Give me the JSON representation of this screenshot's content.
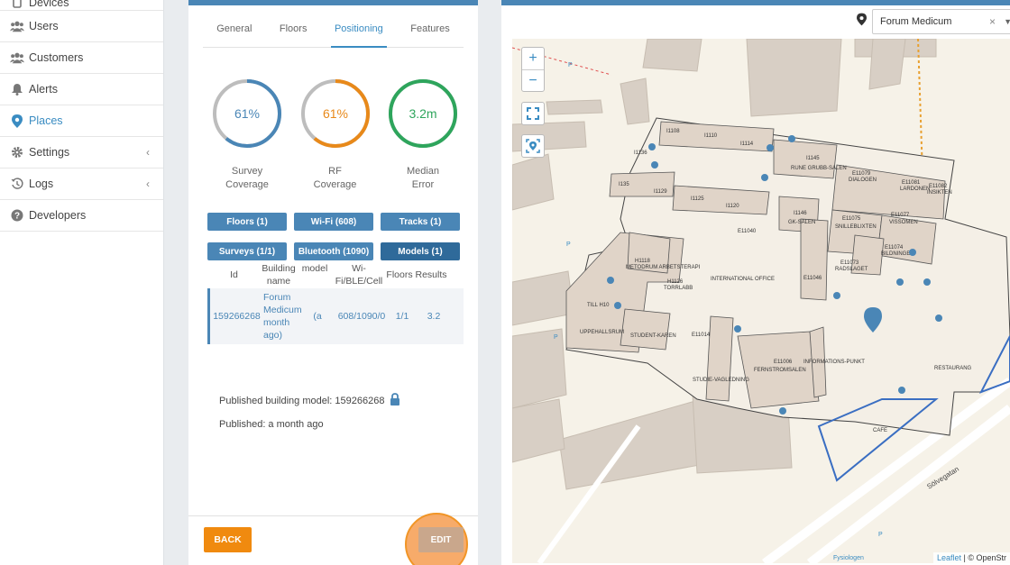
{
  "sidebar": {
    "items": [
      {
        "label": "Devices",
        "icon": "device-icon"
      },
      {
        "label": "Users",
        "icon": "users-icon"
      },
      {
        "label": "Customers",
        "icon": "customers-icon"
      },
      {
        "label": "Alerts",
        "icon": "bell-icon"
      },
      {
        "label": "Places",
        "icon": "map-pin-icon",
        "active": true
      },
      {
        "label": "Settings",
        "icon": "gear-icon"
      },
      {
        "label": "Logs",
        "icon": "history-icon"
      },
      {
        "label": "Developers",
        "icon": "help-icon"
      }
    ]
  },
  "tabs": [
    "General",
    "Floors",
    "Positioning",
    "Features"
  ],
  "active_tab": "Positioning",
  "gauges": [
    {
      "value_text": "61%",
      "fraction": 0.61,
      "color": "#4a86b6",
      "label_line1": "Survey",
      "label_line2": "Coverage"
    },
    {
      "value_text": "61%",
      "fraction": 0.61,
      "color": "#e8891a",
      "label_line1": "RF",
      "label_line2": "Coverage"
    },
    {
      "value_text": "3.2m",
      "fraction": 1.0,
      "color": "#2ea55c",
      "label_line1": "Median",
      "label_line2": "Error"
    }
  ],
  "chips": [
    "Floors (1)",
    "Wi-Fi (608)",
    "Tracks (1)",
    "Surveys (1/1)",
    "Bluetooth (1090)",
    "Models (1)"
  ],
  "models_table": {
    "headers": {
      "id": "Id",
      "building": "Building name",
      "model": "model",
      "wifi": "Wi-Fi/BLE/Cell",
      "floors": "Floors",
      "results": "Results"
    },
    "row": {
      "id": "159266268",
      "building": "Forum Medicum month ago)",
      "model": "(a",
      "wifi": "608/1090/0",
      "floors": "1/1",
      "results": "3.2"
    }
  },
  "published": {
    "model_text": "Published building model: 159266268",
    "ago_text": "Published: a month ago"
  },
  "buttons": {
    "back": "BACK",
    "edit": "EDIT"
  },
  "map": {
    "place": "Forum Medicum",
    "clear": "×",
    "zoom_in": "+",
    "zoom_out": "−",
    "street": "Sölvegatan",
    "bus_stop": "Fysiologen",
    "attribution_leaflet": "Leaflet",
    "attribution_rest": "| © OpenStr",
    "rooms": [
      "I1108",
      "I1110",
      "I1114",
      "I1145",
      "I1136",
      "I135",
      "I1129",
      "I1125",
      "I1120",
      "RUNE GRUBB-SALEN",
      "I1146",
      "GK-SALEN",
      "E11079",
      "DIALOGEN",
      "E11081",
      "LARDONEN",
      "E11082",
      "INSIKTEN",
      "E11075",
      "SNILLEBLIXTEN",
      "E11077",
      "VISSOMEN",
      "E11074",
      "BILDNINGEN",
      "E11073",
      "RADSLAGET",
      "E11040",
      "INTERNATIONAL OFFICE",
      "E11046",
      "H1118",
      "METODRUM ARBETSTERAPI",
      "H1126",
      "TORRLABB",
      "TILL H10",
      "UPPEHALLSRUM",
      "STUDENT-KAREN",
      "E11014",
      "STUDIE-VAGLEDNING",
      "E11006",
      "FERNSTROMSALEN",
      "INFORMATIONS-PUNKT",
      "RESTAURANG",
      "CAFE"
    ]
  }
}
